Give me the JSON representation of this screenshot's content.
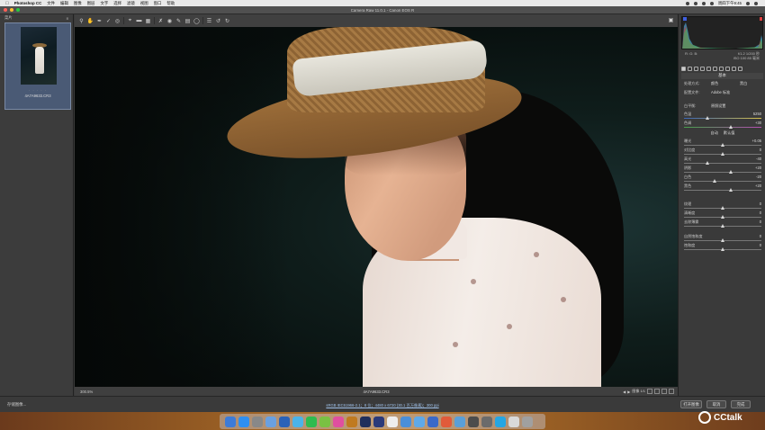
{
  "menubar": {
    "app": "Photoshop CC",
    "items": [
      "文件",
      "编辑",
      "图像",
      "图层",
      "文字",
      "选择",
      "滤镜",
      "视图",
      "窗口",
      "帮助"
    ],
    "clock": "周四下午9:45"
  },
  "window": {
    "title": "Camera Raw 11.0.1  -  Canon EOS R",
    "colors": {
      "close": "#ff5f57",
      "minimize": "#febc2e",
      "zoom": "#28c840"
    }
  },
  "filmstrip": {
    "header": "菜片",
    "thumb_stars": "· · · · ·",
    "thumb_name": "4A7A9633.CR3"
  },
  "toolbar": {
    "tools": [
      "zoom-icon",
      "hand-icon",
      "white-balance-icon",
      "color-sampler-icon",
      "target-adjust-icon",
      "crop-icon",
      "straighten-icon",
      "transform-icon",
      "spot-removal-icon",
      "redeye-icon",
      "brush-icon",
      "graduated-filter-icon",
      "radial-filter-icon",
      "preferences-icon",
      "rotate-left-icon",
      "rotate-right-icon"
    ]
  },
  "canvas_status": {
    "zoom": "300.5%",
    "filename": "4A7A9633.CR3",
    "nav": "图像 1/1"
  },
  "panel": {
    "camera_info": {
      "left": "f/1.2  1/200 秒",
      "right": "ISO 100  85 毫米"
    },
    "title": "基本",
    "rows": [
      {
        "label": "处理方式:",
        "mid": "颜色",
        "mid2": "黑白"
      },
      {
        "label": "配置文件:",
        "mid": "Adobe 标准"
      },
      {
        "label": "白平衡:",
        "mid": "原照设置"
      },
      {
        "label": "色温",
        "value": "5250",
        "pos": 0.3,
        "kind": "temp"
      },
      {
        "label": "色调",
        "value": "+30",
        "pos": 0.6,
        "kind": "tint"
      },
      {
        "label": "曝光",
        "value": "+0.05",
        "pos": 0.5
      },
      {
        "label": "对比度",
        "value": "0",
        "pos": 0.5
      },
      {
        "label": "高光",
        "value": "-40",
        "pos": 0.3
      },
      {
        "label": "阴影",
        "value": "+20",
        "pos": 0.6
      },
      {
        "label": "白色",
        "value": "-20",
        "pos": 0.4
      },
      {
        "label": "黑色",
        "value": "+20",
        "pos": 0.6
      },
      {
        "label": "纹理",
        "value": "0",
        "pos": 0.5
      },
      {
        "label": "清晰度",
        "value": "0",
        "pos": 0.5
      },
      {
        "label": "去除薄雾",
        "value": "0",
        "pos": 0.5
      },
      {
        "label": "自然饱和度",
        "value": "0",
        "pos": 0.5
      },
      {
        "label": "饱和度",
        "value": "0",
        "pos": 0.5
      }
    ],
    "auto": "自动",
    "default": "默认值"
  },
  "bottom": {
    "save": "存储图像...",
    "info": "sRGB IEC61966-2.1；8 位；4480 x 6720 (30.1 百万像素)；300 ppi",
    "open": "打开图像",
    "cancel": "取消",
    "done": "完成"
  },
  "watermark": "CCtalk",
  "dock_icons": [
    "#3d7bd8",
    "#2f8ff0",
    "#888888",
    "#6aa0e0",
    "#2a62b8",
    "#4bb3e8",
    "#2fbb4f",
    "#7ac143",
    "#e04fa0",
    "#c07a20",
    "#1f2f5c",
    "#2b3a7a",
    "#eeeeee",
    "#4a8fd9",
    "#5fa9e8",
    "#3a69c9",
    "#e15b3a",
    "#5a9fd8",
    "#4c4c4c",
    "#6b6b6b",
    "#26a6e3",
    "#d9d9d9",
    "#a0a0a0"
  ]
}
